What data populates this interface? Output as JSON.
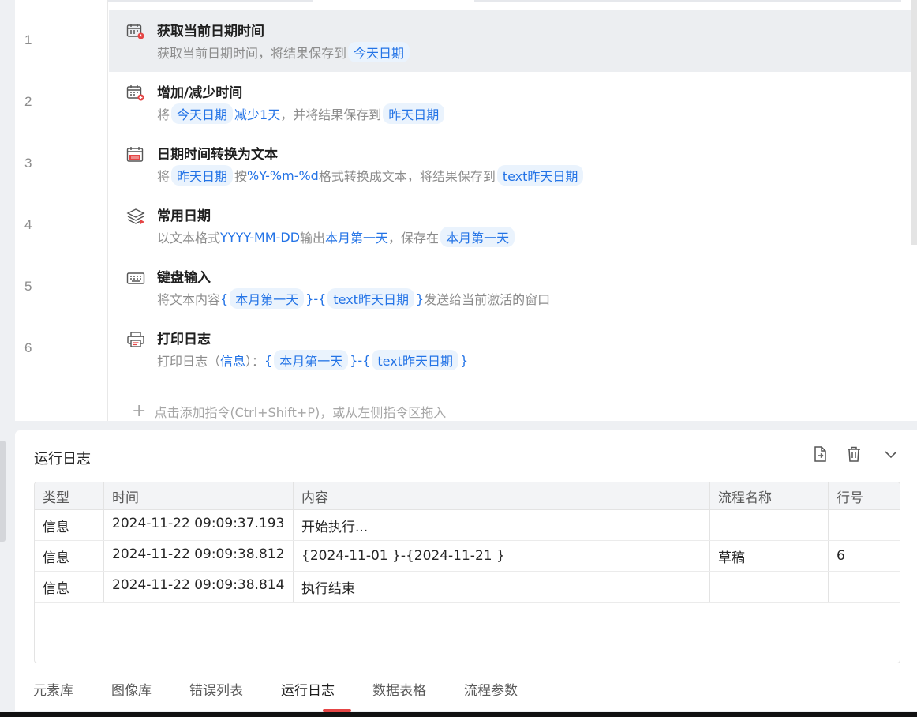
{
  "editor": {
    "line_numbers": [
      "1",
      "2",
      "3",
      "4",
      "5",
      "6"
    ],
    "steps": [
      {
        "icon": "calendar-clock-icon",
        "title": "获取当前日期时间",
        "desc": [
          {
            "t": "text",
            "v": "获取当前日期时间，将结果保存到"
          },
          {
            "t": "chip",
            "v": "今天日期"
          }
        ]
      },
      {
        "icon": "calendar-add-icon",
        "title": "增加/减少时间",
        "desc": [
          {
            "t": "text",
            "v": "将"
          },
          {
            "t": "chip",
            "v": "今天日期"
          },
          {
            "t": "hl",
            "v": "减少1天"
          },
          {
            "t": "text",
            "v": "，并将结果保存到"
          },
          {
            "t": "chip",
            "v": "昨天日期"
          }
        ]
      },
      {
        "icon": "calendar-text-icon",
        "title": "日期时间转换为文本",
        "desc": [
          {
            "t": "text",
            "v": "将"
          },
          {
            "t": "chip",
            "v": "昨天日期"
          },
          {
            "t": "text",
            "v": "按"
          },
          {
            "t": "hl",
            "v": "%Y-%m-%d"
          },
          {
            "t": "text",
            "v": "格式转换成文本，将结果保存到"
          },
          {
            "t": "chip",
            "v": "text昨天日期"
          }
        ]
      },
      {
        "icon": "layers-icon",
        "title": "常用日期",
        "desc": [
          {
            "t": "text",
            "v": "以文本格式"
          },
          {
            "t": "hl",
            "v": "YYYY-MM-DD"
          },
          {
            "t": "text",
            "v": "输出"
          },
          {
            "t": "hl",
            "v": "本月第一天"
          },
          {
            "t": "text",
            "v": "，保存在"
          },
          {
            "t": "chip",
            "v": "本月第一天"
          }
        ]
      },
      {
        "icon": "keyboard-icon",
        "title": "键盘输入",
        "desc": [
          {
            "t": "text",
            "v": "将文本内容"
          },
          {
            "t": "hl",
            "v": "{"
          },
          {
            "t": "chip",
            "v": "本月第一天"
          },
          {
            "t": "hl",
            "v": "}-{"
          },
          {
            "t": "chip",
            "v": "text昨天日期"
          },
          {
            "t": "hl",
            "v": "}"
          },
          {
            "t": "text",
            "v": "发送给当前激活的窗口"
          }
        ]
      },
      {
        "icon": "printer-icon",
        "title": "打印日志",
        "desc": [
          {
            "t": "text",
            "v": "打印日志（"
          },
          {
            "t": "hl",
            "v": "信息"
          },
          {
            "t": "text",
            "v": "）："
          },
          {
            "t": "hl",
            "v": "{"
          },
          {
            "t": "chip",
            "v": "本月第一天"
          },
          {
            "t": "hl",
            "v": "}-{"
          },
          {
            "t": "chip",
            "v": "text昨天日期"
          },
          {
            "t": "hl",
            "v": "}"
          }
        ]
      }
    ],
    "add_hint": "点击添加指令(Ctrl+Shift+P)，或从左侧指令区拖入"
  },
  "log_panel": {
    "title": "运行日志",
    "columns": [
      "类型",
      "时间",
      "内容",
      "流程名称",
      "行号"
    ],
    "rows": [
      {
        "type": "信息",
        "time": "2024-11-22 09:09:37.193",
        "content": "开始执行...",
        "flow": "",
        "line": ""
      },
      {
        "type": "信息",
        "time": "2024-11-22 09:09:38.812",
        "content": "{2024-11-01 }-{2024-11-21 }",
        "flow": "草稿",
        "line": "6"
      },
      {
        "type": "信息",
        "time": "2024-11-22 09:09:38.814",
        "content": "执行结束",
        "flow": "",
        "line": ""
      }
    ]
  },
  "bottom_tabs": {
    "items": [
      "元素库",
      "图像库",
      "错误列表",
      "运行日志",
      "数据表格",
      "流程参数"
    ],
    "active": "运行日志"
  },
  "colors": {
    "accent": "#2373e6",
    "chip_bg": "#eaf3fd",
    "icon_red": "#e54545"
  }
}
